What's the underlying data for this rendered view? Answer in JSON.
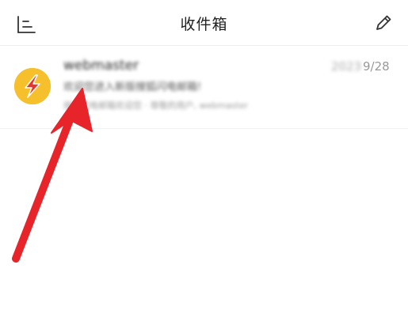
{
  "header": {
    "title": "收件箱",
    "menu_icon": "sort-list-icon",
    "compose_icon": "pencil-icon"
  },
  "mail_list": [
    {
      "sender": "webmaster",
      "date_blurred": "2023",
      "date": "9/28",
      "subject": "欢迎您进入新版搜狐闪电邮箱!",
      "preview": "搜狐闪电邮箱欢迎您 · 尊敬的用户, webmaster",
      "avatar_icon": "lightning-bolt-icon"
    }
  ],
  "annotation": {
    "arrow_color": "#e8242b"
  },
  "colors": {
    "avatar_bg": "#f5c02b",
    "avatar_bolt": "#e8352b",
    "title_text": "#222222"
  }
}
